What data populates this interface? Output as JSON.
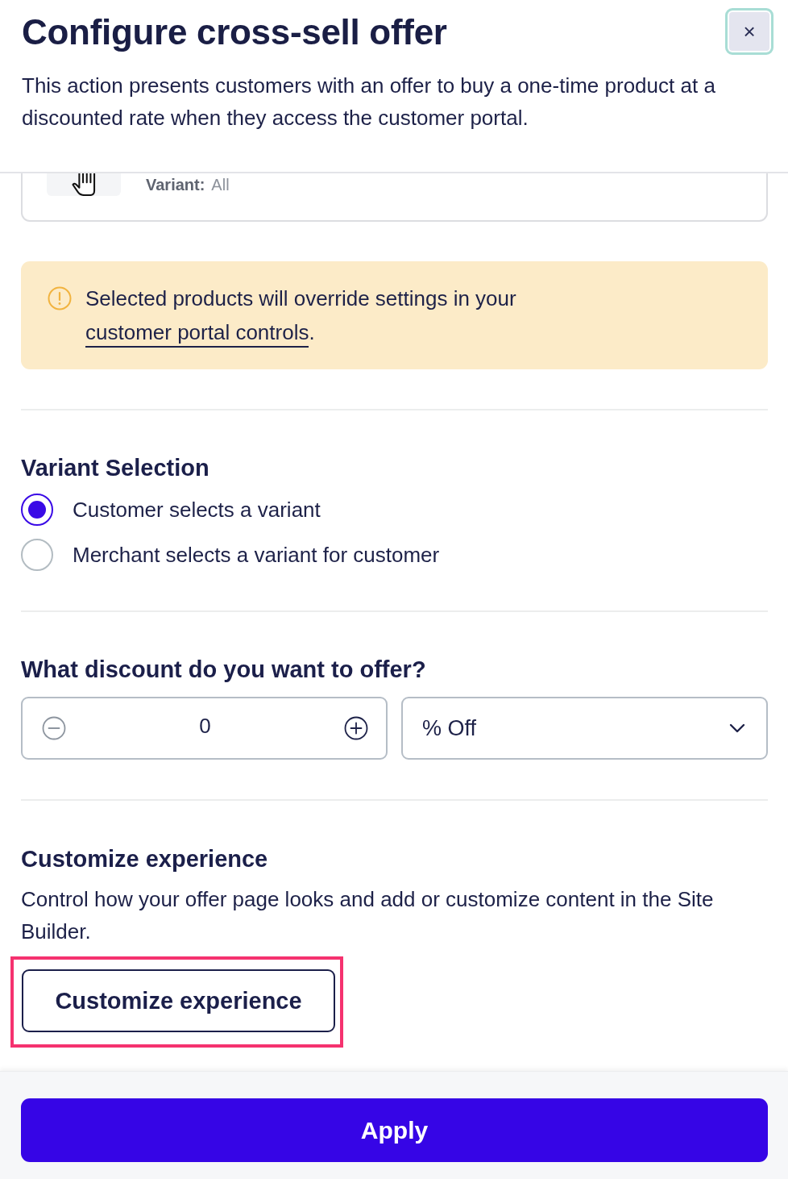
{
  "dialog": {
    "title": "Configure cross-sell offer",
    "close_button": {
      "label": "×",
      "focused": true
    },
    "description": "This action presents customers with an offer to buy a one-time product at a discounted rate when they access the customer portal."
  },
  "product_card": {
    "variant_label": "Variant:",
    "variant_value": "All"
  },
  "notice": {
    "text_before": "Selected products will override settings in your ",
    "link": "customer portal controls",
    "text_after": "."
  },
  "variant_selection": {
    "heading": "Variant Selection",
    "options": [
      {
        "label": "Customer selects a variant",
        "selected": true
      },
      {
        "label": "Merchant selects a variant for customer",
        "selected": false
      }
    ]
  },
  "discount": {
    "heading": "What discount do you want to offer?",
    "stepper": {
      "value": "0",
      "decrement_disabled": true
    },
    "type_select": {
      "value": "% Off"
    }
  },
  "customize": {
    "heading": "Customize experience",
    "description": "Control how your offer page looks and add or customize content in the Site Builder.",
    "button": {
      "label": "Customize experience",
      "highlighted": true
    }
  },
  "footer": {
    "apply_button": "Apply"
  }
}
